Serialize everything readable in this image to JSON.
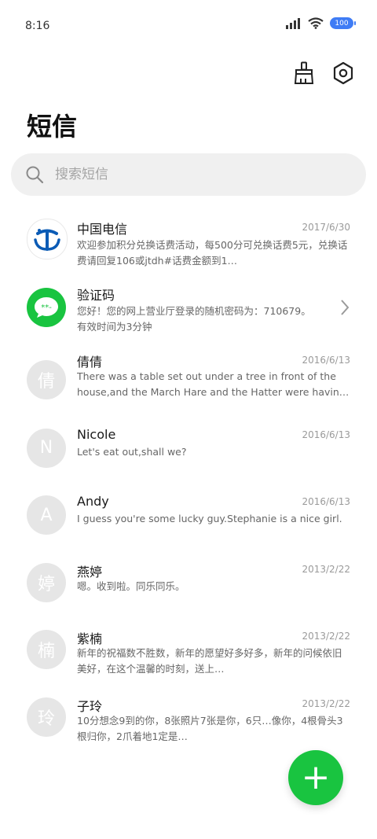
{
  "status_bar": {
    "time": "8:16",
    "battery": "100",
    "icons": [
      "signal-icon",
      "wifi-icon",
      "battery-icon"
    ]
  },
  "toolbar": {
    "actions": [
      "clean-brush-icon",
      "settings-gear-icon"
    ]
  },
  "page": {
    "title": "短信"
  },
  "search": {
    "placeholder": "搜索短信"
  },
  "threads": [
    {
      "sender": "中国电信",
      "date": "2017/6/30",
      "preview": "欢迎参加积分兑换话费活动，每500分可兑换话费5元，兑换话费请回复106或jtdh#话费金额到1…",
      "avatar": "china-telecom-logo"
    },
    {
      "sender": "验证码",
      "date": "",
      "preview": "您好！您的网上营业厅登录的随机密码为：710679。有效时间为3分钟",
      "avatar": "message-bubble-icon"
    },
    {
      "sender": "倩倩",
      "date": "2016/6/13",
      "preview": "There was a table set out under a tree in front of the house,and the March Hare and the Hatter were havin…",
      "avatar_letter": "倩"
    },
    {
      "sender": "Nicole",
      "date": "2016/6/13",
      "preview": "Let's eat out,shall we?",
      "avatar_letter": "N"
    },
    {
      "sender": "Andy",
      "date": "2016/6/13",
      "preview": "I guess you're some lucky guy.Stephanie is a nice girl.",
      "avatar_letter": "A"
    },
    {
      "sender": "燕婷",
      "date": "2013/2/22",
      "preview": "嗯。收到啦。同乐同乐。",
      "avatar_letter": "婷"
    },
    {
      "sender": "紫楠",
      "date": "2013/2/22",
      "preview": "新年的祝福数不胜数，新年的愿望好多好多，新年的问候依旧美好，在这个温馨的时刻，送上…",
      "avatar_letter": "楠"
    },
    {
      "sender": "子玲",
      "date": "2013/2/22",
      "preview": "10分想念9到的你，8张照片7张是你，6只…像你，4根骨头3根归你，2爪着地1定是…",
      "avatar_letter": "玲"
    }
  ],
  "fab": {
    "label": "+"
  },
  "colors": {
    "accent": "#19c440",
    "avatar_gray": "#e6e6e6",
    "telecom_blue": "#0b5bb5"
  }
}
